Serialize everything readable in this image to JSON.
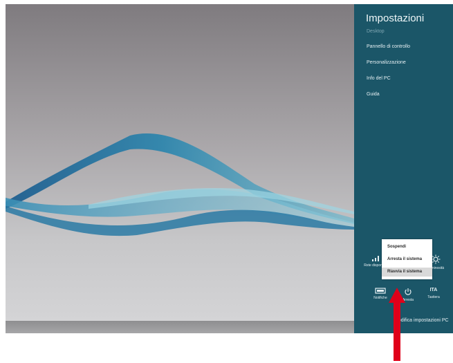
{
  "charm": {
    "title": "Impostazioni",
    "subtitle": "Desktop",
    "links": [
      "Pannello di controllo",
      "Personalizzazione",
      "Info del PC",
      "Guida"
    ],
    "pc_settings_link": "Modifica impostazioni PC",
    "tiles": {
      "network_label": "Rete disponibile",
      "brightness_label": "Luminosità",
      "notifications_label": "Notifiche",
      "power_label": "Arresta",
      "keyboard_abbr": "ITA",
      "keyboard_label": "Tastiera"
    }
  },
  "power_menu": {
    "items": [
      "Sospendi",
      "Arresta il sistema",
      "Riavvia il sistema"
    ],
    "highlighted_index": 2
  },
  "colors": {
    "charm_bg": "#1b5668",
    "arrow": "#e0001a",
    "wave": "#2f86ad"
  },
  "icons": {
    "network": "network-signal-icon",
    "brightness": "sun-icon",
    "notifications": "notifications-icon",
    "power": "power-icon",
    "arrow": "red-arrow-up"
  }
}
